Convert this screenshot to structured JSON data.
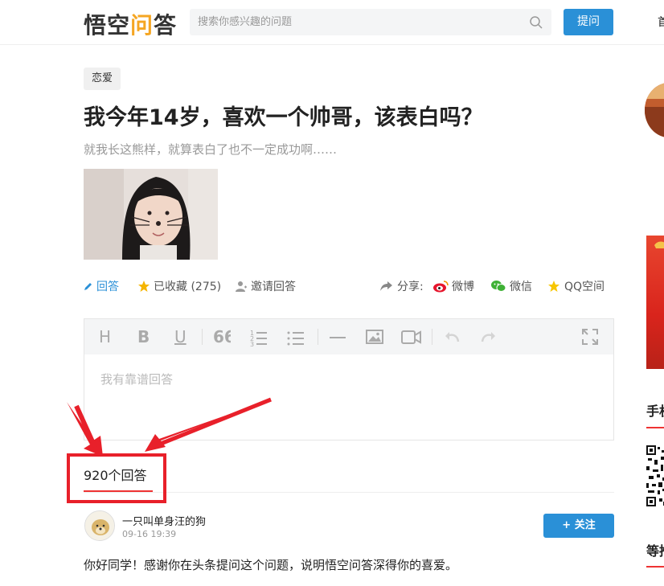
{
  "header": {
    "logo_text_pre": "悟空",
    "logo_text_accent": "问",
    "logo_text_post": "答",
    "search_placeholder": "搜索你感兴趣的问题",
    "ask_label": "提问",
    "nav_home": "首"
  },
  "question": {
    "tag": "恋爱",
    "title": "我今年14岁，喜欢一个帅哥，该表白吗？",
    "description": "就我长这熊样，就算表白了也不一定成功啊……"
  },
  "actions": {
    "answer": "回答",
    "collected": "已收藏 (275)",
    "invite": "邀请回答",
    "share": "分享:",
    "weibo": "微博",
    "wechat": "微信",
    "qzone": "QQ空间"
  },
  "editor": {
    "placeholder": "我有靠谱回答"
  },
  "answers": {
    "count_label": "920个回答",
    "first": {
      "author": "一只叫单身汪的狗",
      "time": "09-16 19:39",
      "follow_label": "+ 关注",
      "text": "你好同学！感谢你在头条提问这个问题，说明悟空问答深得你的喜爱。"
    }
  },
  "sidebar": {
    "title1": "手机",
    "title2": "等推"
  },
  "colors": {
    "brand_blue": "#2a90d7",
    "accent_red": "#e8202a"
  }
}
